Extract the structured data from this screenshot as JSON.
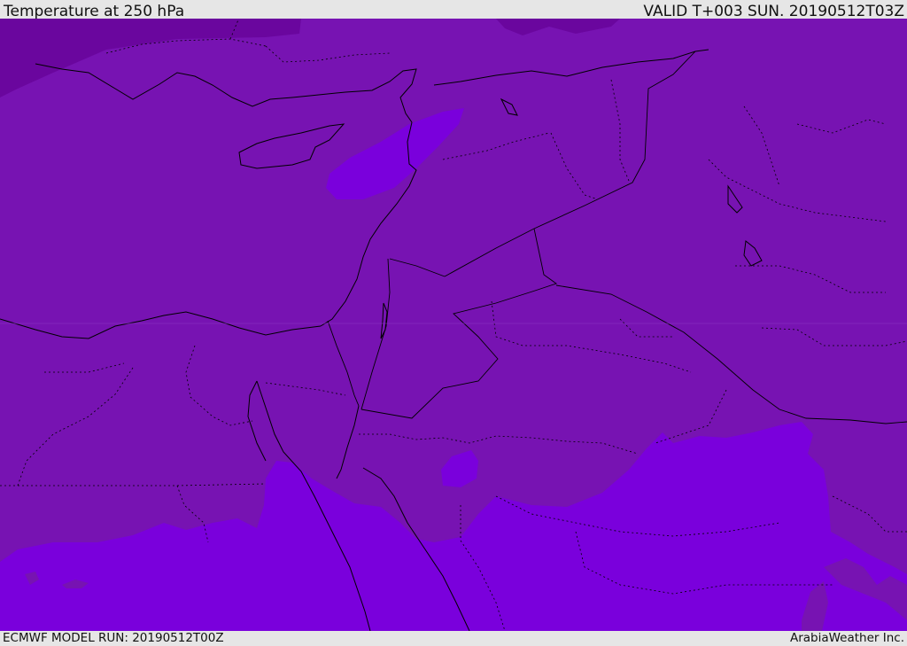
{
  "header": {
    "title": "Temperature at 250 hPa",
    "valid": "VALID T+003 SUN. 20190512T03Z"
  },
  "footer": {
    "model_run": "ECMWF MODEL RUN: 20190512T00Z",
    "credit": "ArabiaWeather Inc."
  },
  "colors": {
    "base_fill": "#7713b2",
    "cold_fill": "#6a069e",
    "warm_fill": "#7a00dc",
    "border_line": "#000000",
    "bar_background": "#e6e6e6"
  }
}
